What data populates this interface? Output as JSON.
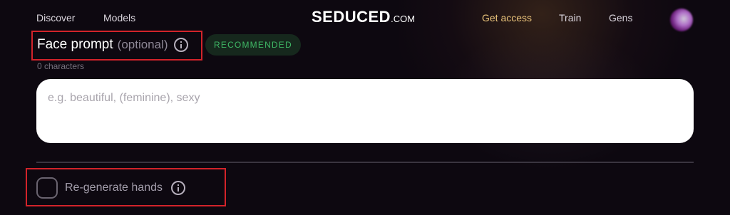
{
  "nav": {
    "discover": "Discover",
    "models": "Models",
    "logo_main": "SEDUCED",
    "logo_suffix": ".COM",
    "get_access": "Get access",
    "train": "Train",
    "gens": "Gens"
  },
  "face_prompt": {
    "title": "Face prompt",
    "optional": "(optional)",
    "badge": "RECOMMENDED",
    "char_count": "0 characters",
    "placeholder": "e.g. beautiful, (feminine), sexy",
    "value": ""
  },
  "hands": {
    "label": "Re-generate hands",
    "checked": false
  },
  "colors": {
    "background": "#0d0810",
    "accent_gold": "#e8c27a",
    "badge_green": "#3fb765",
    "annotation_red": "#d2232a"
  }
}
